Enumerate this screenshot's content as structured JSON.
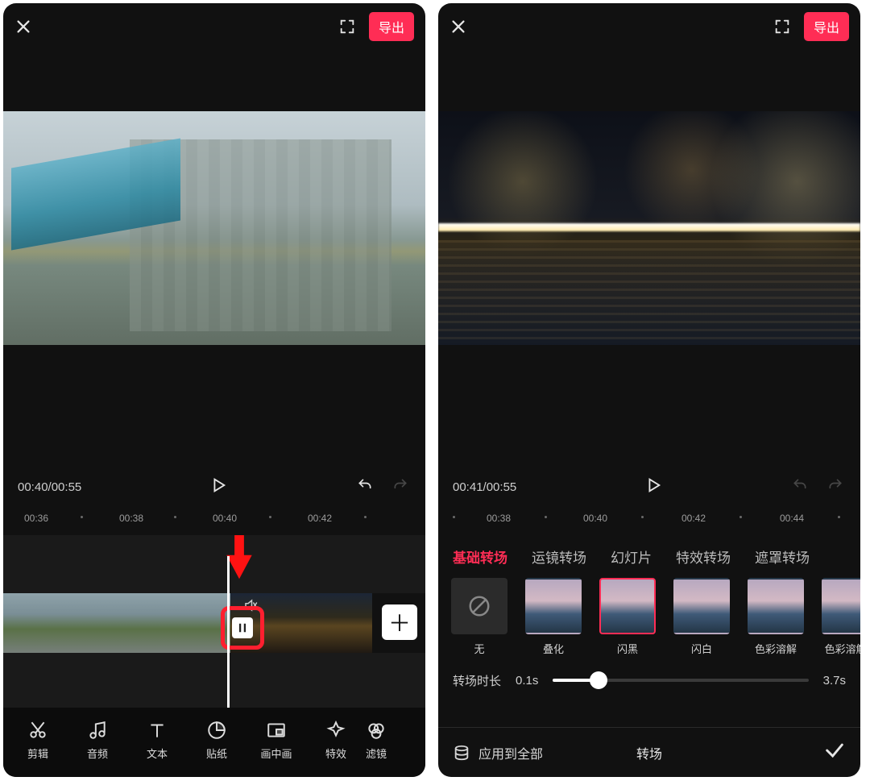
{
  "colors": {
    "accent": "#ff2d55",
    "highlight": "#ff1f2f"
  },
  "left": {
    "export_label": "导出",
    "time_current": "00:40",
    "time_total": "00:55",
    "ruler": [
      "00:36",
      "00:38",
      "00:40",
      "00:42"
    ],
    "tools": [
      {
        "id": "cut",
        "label": "剪辑"
      },
      {
        "id": "audio",
        "label": "音频"
      },
      {
        "id": "text",
        "label": "文本"
      },
      {
        "id": "sticker",
        "label": "贴纸"
      },
      {
        "id": "pip",
        "label": "画中画"
      },
      {
        "id": "fx",
        "label": "特效"
      },
      {
        "id": "filter",
        "label": "滤镜"
      }
    ]
  },
  "right": {
    "export_label": "导出",
    "time_current": "00:41",
    "time_total": "00:55",
    "ruler": [
      "00:38",
      "00:40",
      "00:42",
      "00:44"
    ],
    "tabs": [
      {
        "id": "basic",
        "label": "基础转场",
        "active": true
      },
      {
        "id": "camera",
        "label": "运镜转场",
        "active": false
      },
      {
        "id": "slide",
        "label": "幻灯片",
        "active": false
      },
      {
        "id": "fx",
        "label": "特效转场",
        "active": false
      },
      {
        "id": "mask",
        "label": "遮罩转场",
        "active": false
      }
    ],
    "presets": [
      {
        "id": "none",
        "label": "无",
        "none": true,
        "selected": false
      },
      {
        "id": "dissolve",
        "label": "叠化",
        "selected": false
      },
      {
        "id": "flashblack",
        "label": "闪黑",
        "selected": true
      },
      {
        "id": "flashwhite",
        "label": "闪白",
        "selected": false
      },
      {
        "id": "colordissolve",
        "label": "色彩溶解",
        "selected": false
      },
      {
        "id": "colordissolve2",
        "label": "色彩溶解 II",
        "selected": false
      }
    ],
    "duration_label": "转场时长",
    "duration_min": "0.1s",
    "duration_max": "3.7s",
    "duration_ratio": 0.18,
    "apply_all_label": "应用到全部",
    "panel_title": "转场"
  }
}
